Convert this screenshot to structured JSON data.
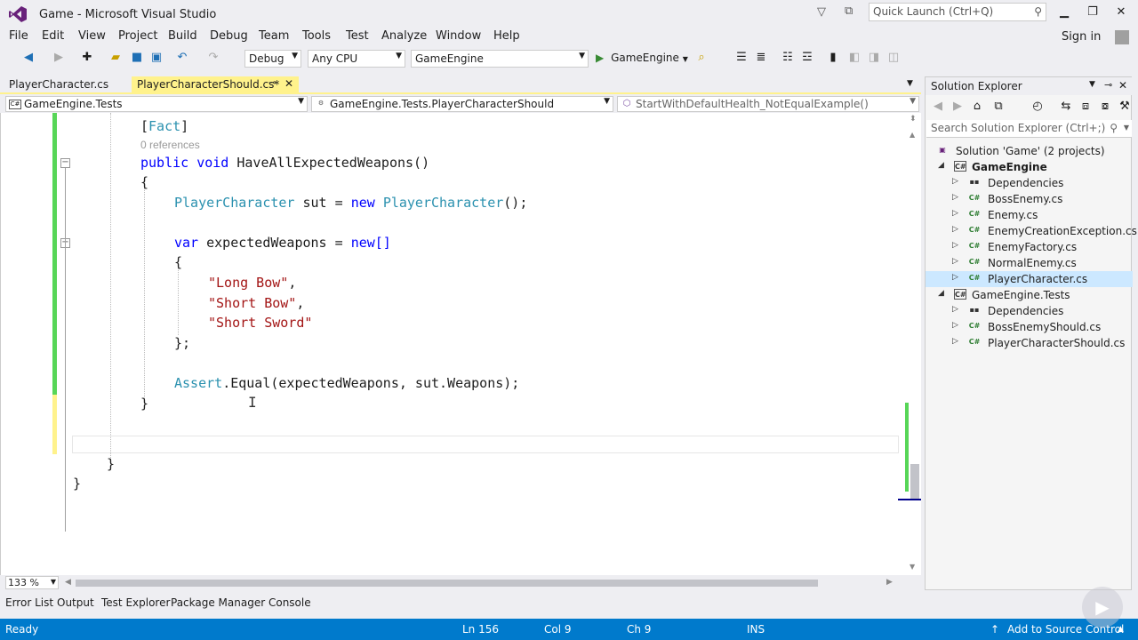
{
  "window": {
    "title": "Game - Microsoft Visual Studio",
    "quick_launch_placeholder": "Quick Launch (Ctrl+Q)"
  },
  "menu": [
    "File",
    "Edit",
    "View",
    "Project",
    "Build",
    "Debug",
    "Team",
    "Tools",
    "Test",
    "Analyze",
    "Window",
    "Help"
  ],
  "sign_in": "Sign in",
  "toolbar": {
    "configuration": "Debug",
    "platform": "Any CPU",
    "startup_project": "GameEngine",
    "run_label": "GameEngine"
  },
  "doc_tabs": [
    {
      "label": "PlayerCharacter.cs"
    },
    {
      "label": "PlayerCharacterShould.cs*"
    }
  ],
  "nav": {
    "project": "GameEngine.Tests",
    "type": "GameEngine.Tests.PlayerCharacterShould",
    "member": "StartWithDefaultHealth_NotEqualExample()"
  },
  "code": {
    "fact_attr": "Fact",
    "references": "0 references",
    "method_sig": "HaveAllExpectedWeapons()",
    "kw_public": "public",
    "kw_void": "void",
    "type_player": "PlayerCharacter",
    "var_sut": " sut = ",
    "kw_new": "new",
    "kw_var": "var",
    "var_expected": " expectedWeapons = ",
    "new_arr": "new[]",
    "weapons": [
      "\"Long Bow\"",
      "\"Short Bow\"",
      "\"Short Sword\""
    ],
    "assert_type": "Assert",
    "assert_call": ".Equal(expectedWeapons, sut.Weapons);"
  },
  "zoom": "133 %",
  "bottom_tabs": [
    "Error List",
    "Output",
    "Test Explorer",
    "Package Manager Console"
  ],
  "status": {
    "ready": "Ready",
    "line": "Ln 156",
    "col": "Col 9",
    "ch": "Ch 9",
    "mode": "INS",
    "source_control": "Add to Source Control"
  },
  "solution_explorer": {
    "title": "Solution Explorer",
    "search_placeholder": "Search Solution Explorer (Ctrl+;)",
    "solution": "Solution 'Game' (2 projects)",
    "projects": [
      {
        "name": "GameEngine",
        "items": [
          "Dependencies",
          "BossEnemy.cs",
          "Enemy.cs",
          "EnemyCreationException.cs",
          "EnemyFactory.cs",
          "NormalEnemy.cs",
          "PlayerCharacter.cs"
        ]
      },
      {
        "name": "GameEngine.Tests",
        "items": [
          "Dependencies",
          "BossEnemyShould.cs",
          "PlayerCharacterShould.cs"
        ]
      }
    ]
  }
}
